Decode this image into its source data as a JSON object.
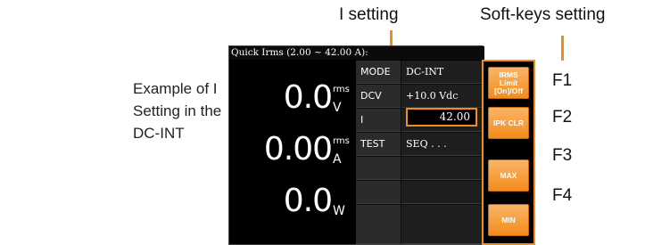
{
  "caption": {
    "line1": "Example of I",
    "line2": "Setting in the",
    "line3": "DC-INT"
  },
  "labels": {
    "i_setting": "I setting",
    "softkeys_setting": "Soft-keys setting"
  },
  "screen": {
    "title": "Quick Irms (2.00 ~ 42.00 A):",
    "measurements": [
      {
        "value": "0.0",
        "superscript": "rms",
        "unit": "V"
      },
      {
        "value": "0.00",
        "superscript": "rms",
        "unit": "A"
      },
      {
        "value": "0.0",
        "superscript": "",
        "unit": "W"
      }
    ],
    "table": [
      {
        "key": "MODE",
        "value": "DC-INT"
      },
      {
        "key": "DCV",
        "value": "+10.0 Vdc"
      },
      {
        "key": "I",
        "value": ""
      },
      {
        "key": "TEST",
        "value": "SEQ . . ."
      },
      {
        "key": "",
        "value": ""
      },
      {
        "key": "",
        "value": ""
      },
      {
        "key": "",
        "value": ""
      }
    ],
    "i_input_value": "42.00"
  },
  "softkeys": [
    {
      "label": "IRMS\nLimit\n[On]/Off",
      "fkey": "F1"
    },
    {
      "label": "IPK CLR",
      "fkey": "F2"
    },
    {
      "label": "MAX",
      "fkey": "F3"
    },
    {
      "label": "MIN",
      "fkey": "F4"
    }
  ],
  "colors": {
    "accent": "#f28c1b",
    "screen_bg": "#000000"
  }
}
